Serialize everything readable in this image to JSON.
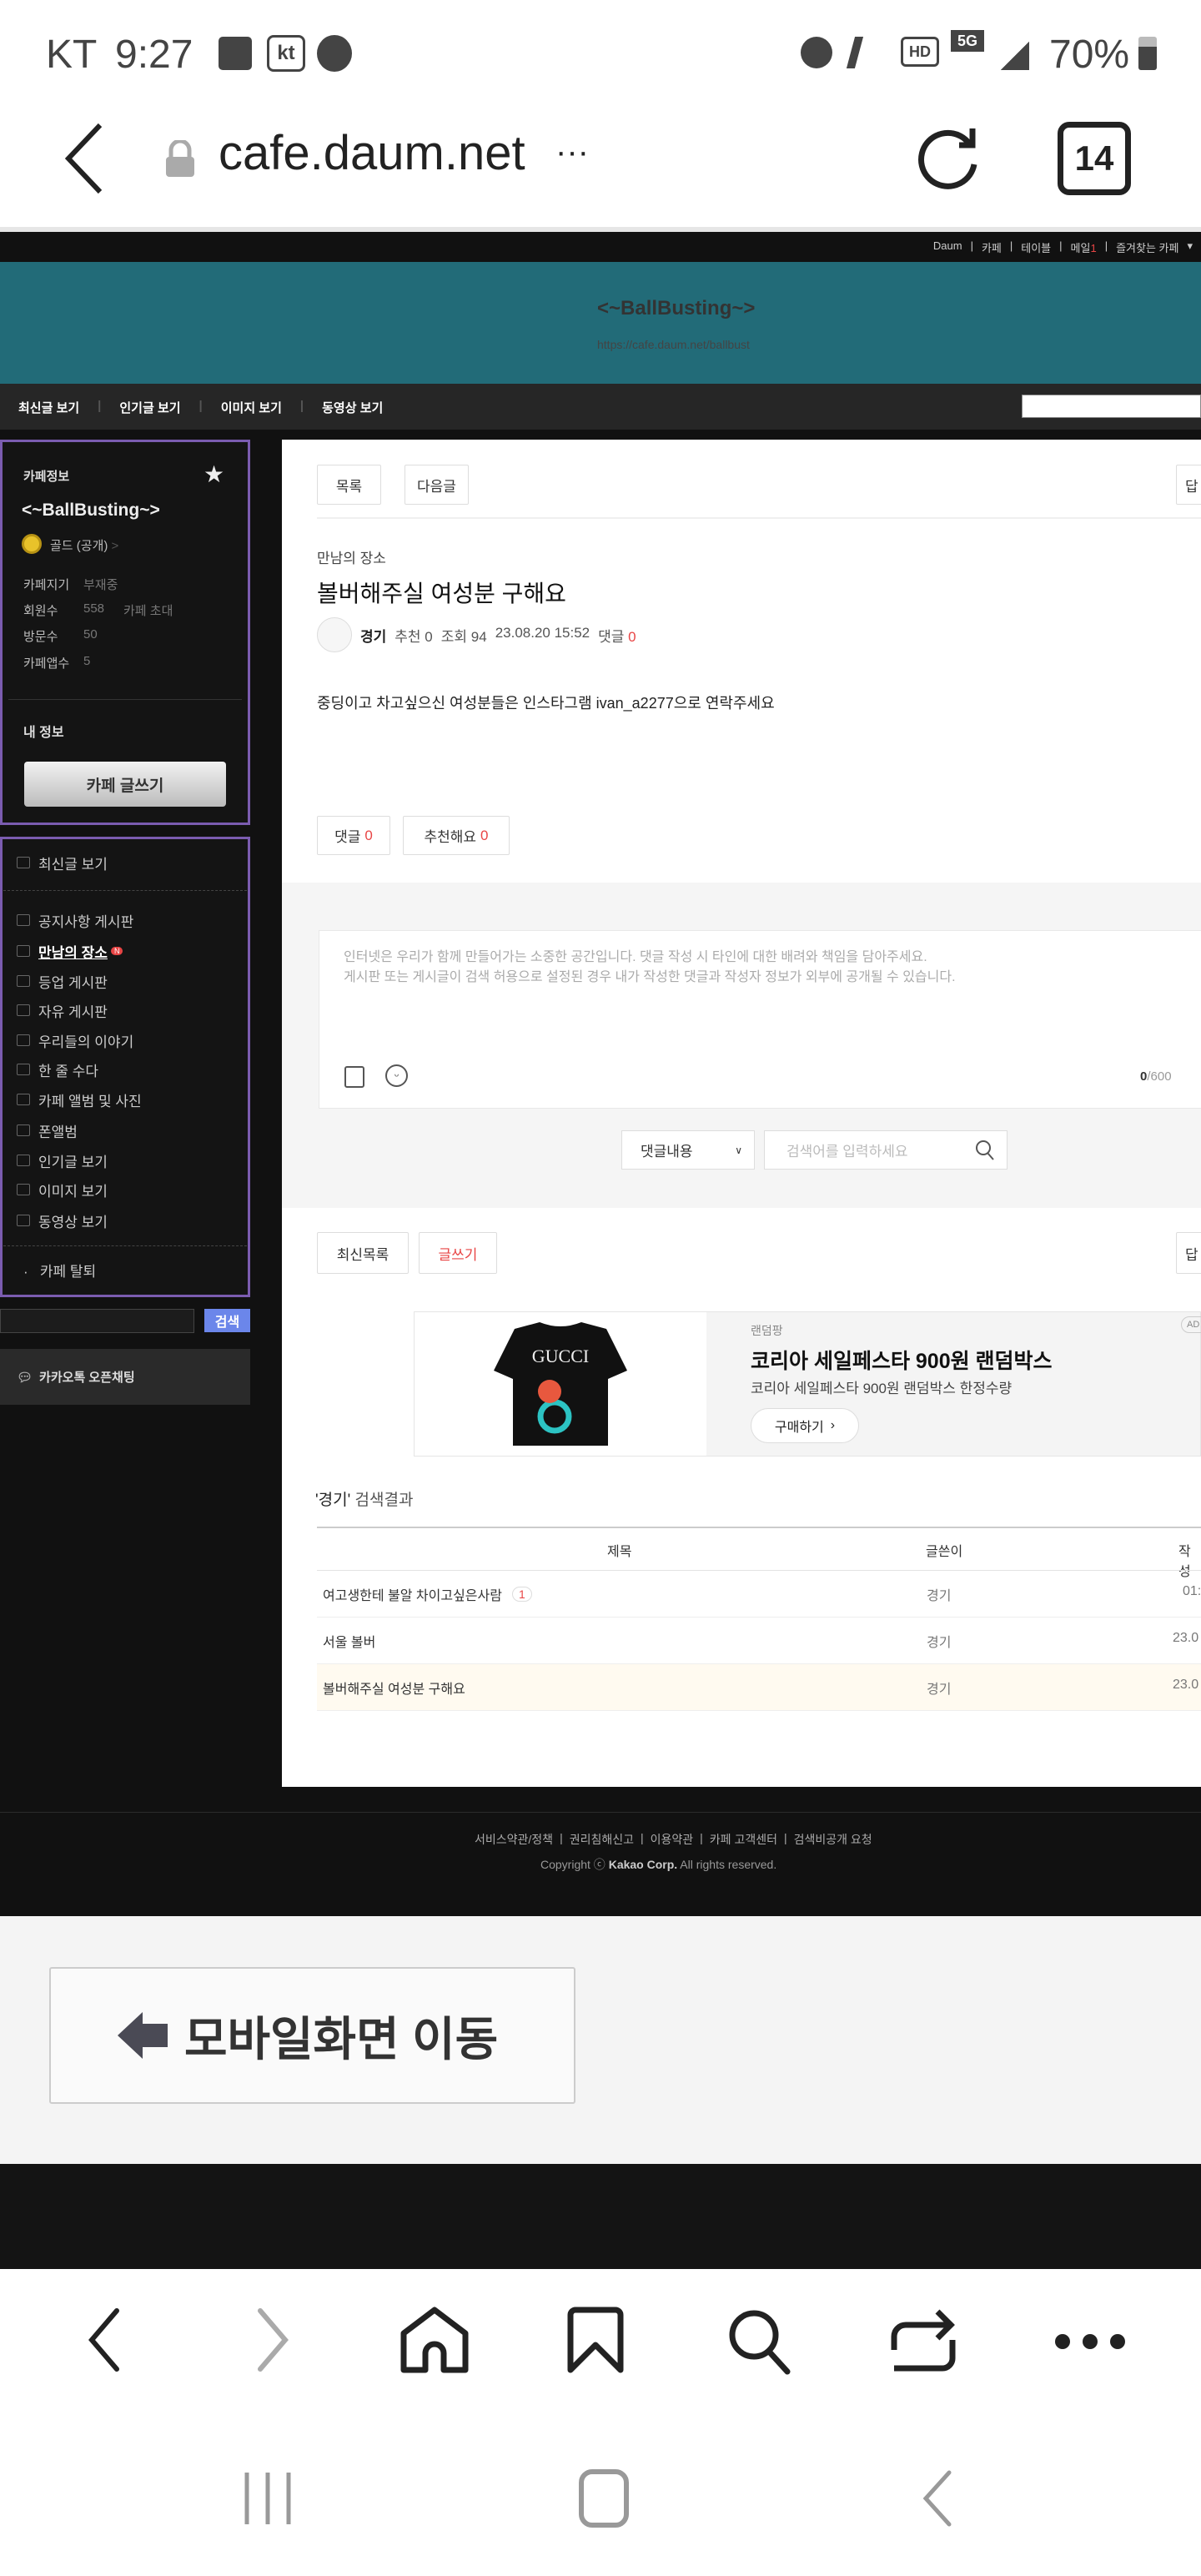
{
  "status_bar": {
    "carrier": "KT",
    "time": "9:27",
    "battery": "70%",
    "icons": [
      "gallery-icon",
      "kt-icon",
      "app-icon",
      "alarm-icon",
      "mute-icon",
      "hd-icon",
      "5g-icon",
      "signal-icon",
      "battery-icon"
    ]
  },
  "browser": {
    "url": "cafe.daum.net",
    "more": "···",
    "tab_count": "14"
  },
  "topbar": {
    "links": [
      "Daum",
      "카페",
      "테이블",
      "메일",
      "즐겨찾는 카페"
    ],
    "mail_count": "1"
  },
  "header": {
    "title": "<~BallBusting~>",
    "url": "https://cafe.daum.net/ballbust",
    "bg": "#226b78"
  },
  "nav": {
    "items": [
      "최신글 보기",
      "인기글 보기",
      "이미지 보기",
      "동영상 보기"
    ]
  },
  "sidebar": {
    "cafe_info_label": "카페정보",
    "cafe_name": "<~BallBusting~>",
    "grade": "골드 (공개)",
    "grade_arrow": ">",
    "stats": [
      {
        "label": "카페지기",
        "value": "부재중"
      },
      {
        "label": "회원수",
        "value": "558",
        "extra": "카페 초대"
      },
      {
        "label": "방문수",
        "value": "50"
      },
      {
        "label": "카페앱수",
        "value": "5"
      }
    ],
    "my_info": "내 정보",
    "write_button": "카페 글쓰기",
    "recent": "최신글 보기",
    "menu": [
      "공지사항 게시판",
      "만남의 장소",
      "등업 게시판",
      "자유 게시판",
      "우리들의 이야기",
      "한 줄 수다",
      "카페 앨범 및 사진",
      "폰앨범",
      "인기글 보기",
      "이미지 보기",
      "동영상 보기"
    ],
    "new_badge": "N",
    "leave": "카페 탈퇴",
    "search_button": "검색",
    "kakao": "카카오톡 오픈채팅",
    "accent": "#7b5cb0"
  },
  "article": {
    "list_button": "목록",
    "next_button": "다음글",
    "right_button": "답",
    "category": "만남의 장소",
    "title": "볼버해주실 여성분 구해요",
    "author": "경기",
    "recommend_label": "추천",
    "recommend": "0",
    "views_label": "조회",
    "views": "94",
    "date": "23.08.20 15:52",
    "comments_label": "댓글",
    "comments": "0",
    "body": "중딩이고 차고싶으신 여성분들은 인스타그램 ivan_a2277으로 연락주세요",
    "comment_btn": "댓글",
    "comment_count": "0",
    "like_btn": "추천해요",
    "like_count": "0"
  },
  "comment_box": {
    "placeholder_1": "인터넷은 우리가 함께 만들어가는 소중한 공간입니다. 댓글 작성 시 타인에 대한 배려와 책임을 담아주세요.",
    "placeholder_2": "게시판 또는 게시글이 검색 허용으로 설정된 경우 내가 작성한 댓글과 작성자 정보가 외부에 공개될 수 있습니다.",
    "count": "0",
    "max": "/600",
    "search_select": "댓글내용",
    "search_placeholder": "검색어를 입력하세요"
  },
  "bottom_buttons": {
    "latest": "최신목록",
    "write": "글쓰기",
    "right": "답"
  },
  "ad": {
    "brand": "랜덤팡",
    "title": "코리아 세일페스타 900원 랜덤박스",
    "desc": "코리아 세일페스타 900원 랜덤박스 한정수량",
    "cta": "구매하기",
    "badge": "AD",
    "image_text": "GUCCI"
  },
  "results": {
    "heading_keyword": "'경기'",
    "heading_rest": "검색결과",
    "columns": [
      "제목",
      "글쓴이",
      "작성"
    ],
    "rows": [
      {
        "title": "여고생한테 불알 차이고싶은사람",
        "badge": "1",
        "author": "경기",
        "date": "01:"
      },
      {
        "title": "서울 볼버",
        "author": "경기",
        "date": "23.0"
      },
      {
        "title": "볼버해주실 여성분 구해요",
        "author": "경기",
        "date": "23.0"
      }
    ]
  },
  "footer": {
    "links": [
      "서비스약관/정책",
      "권리침해신고",
      "이용약관",
      "카페 고객센터",
      "검색비공개 요청"
    ],
    "copyright_pre": "Copyright ⓒ",
    "copyright_corp": "Kakao Corp.",
    "copyright_post": "All rights reserved."
  },
  "mobile_button": "모바일화면 이동"
}
